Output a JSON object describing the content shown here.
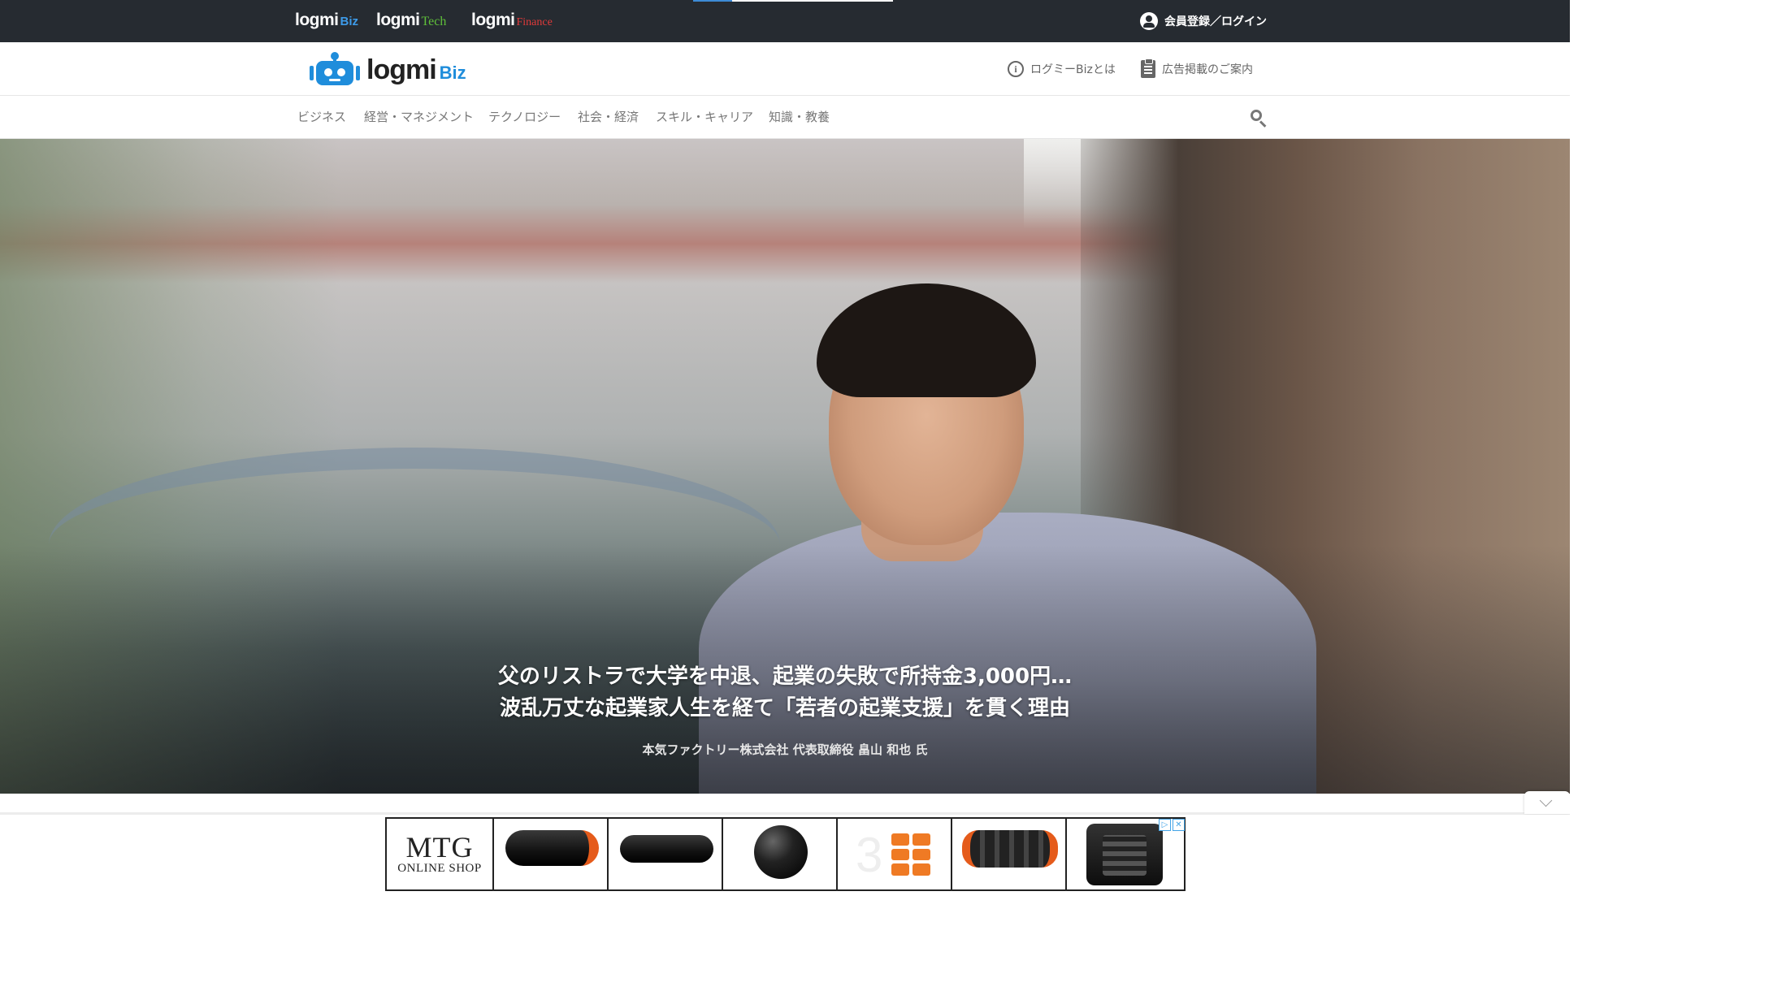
{
  "topbar": {
    "brands": [
      {
        "main": "logmi",
        "sub": "Biz",
        "sub_color": "#3d9be9"
      },
      {
        "main": "logmi",
        "sub": "Tech",
        "sub_color": "#5fbf3a"
      },
      {
        "main": "logmi",
        "sub": "Finance",
        "sub_color": "#e03a3a"
      }
    ],
    "login_label": "会員登録／ログイン",
    "login_icon": "account-circle-icon"
  },
  "header": {
    "logo_main": "logmi",
    "logo_sub": "Biz",
    "logo_color": "#1f8ddb",
    "about_label": "ログミーBizとは",
    "about_icon": "info-circle-icon",
    "ad_info_label": "広告掲載のご案内",
    "ad_info_icon": "clipboard-icon"
  },
  "nav": {
    "items": [
      "ビジネス",
      "経営・マネジメント",
      "テクノロジー",
      "社会・経済",
      "スキル・キャリア",
      "知識・教養"
    ],
    "search_icon": "search-icon"
  },
  "hero": {
    "title_line1": "父のリストラで大学を中退、起業の失敗で所持金3,000円…",
    "title_line2": "波乱万丈な起業家人生を経て「若者の起業支援」を貫く理由",
    "speaker": "本気ファクトリー株式会社 代表取締役 畠山 和也 氏"
  },
  "ad": {
    "brand_line1": "MTG",
    "brand_line2": "ONLINE SHOP",
    "products": [
      "foam-roller-orange",
      "foam-roller-slim",
      "massage-ball",
      "tile-pack",
      "wave-roller",
      "support-belt"
    ],
    "choices_icons": [
      "ad-choices-icon",
      "close-icon"
    ],
    "accent_color": "#e55b1b"
  },
  "colors": {
    "topbar_bg": "#262b31",
    "nav_text": "#777777"
  }
}
